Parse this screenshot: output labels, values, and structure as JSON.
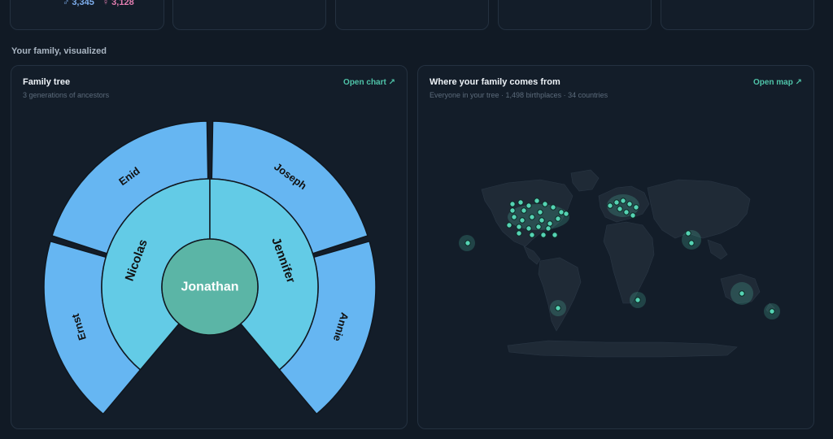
{
  "stats": {
    "male_symbol": "♂",
    "male_count": "3,345",
    "female_symbol": "♀",
    "female_count": "3,128"
  },
  "section": {
    "title": "Your family, visualized"
  },
  "tree_panel": {
    "title": "Family tree",
    "subtitle": "3 generations of ancestors",
    "link": "Open chart ↗",
    "root": "Jonathan",
    "parents": [
      "Nicolas",
      "Jennifer"
    ],
    "grandparents": [
      "Ernst",
      "Enid",
      "Joseph",
      "Annie"
    ],
    "colors": {
      "root": "#5bb5a6",
      "parents": "#63cbe6",
      "grandparents": "#66b6f2",
      "stroke": "#10171f"
    }
  },
  "map_panel": {
    "title": "Where your family comes from",
    "subtitle": "Everyone in your tree · 1,498 birthplaces · 34 countries",
    "link": "Open map ↗",
    "accent": "#55d3b3"
  }
}
